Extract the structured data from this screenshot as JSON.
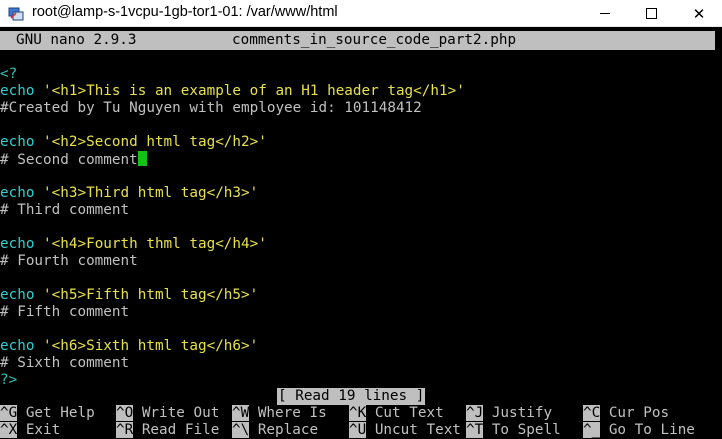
{
  "window": {
    "title": "root@lamp-s-1vcpu-1gb-tor1-01: /var/www/html",
    "minimize_glyph": "",
    "close_glyph": "✕"
  },
  "nano": {
    "version": "GNU nano 2.9.3",
    "filename": "comments_in_source_code_part2.php",
    "status": "[ Read 19 lines ]"
  },
  "code": {
    "open_tag": "<?",
    "l1_kw": "echo",
    "l1_str": "'<h1>This is an example of an H1 header tag</h1>'",
    "l2": "#Created by Tu Nguyen with employee id: 101148412",
    "l3_kw": "echo",
    "l3_str": "'<h2>Second html tag</h2>'",
    "l4": "# Second comment",
    "l5_kw": "echo",
    "l5_str": "'<h3>Third html tag</h3>'",
    "l6": "# Third comment",
    "l7_kw": "echo",
    "l7_str": "'<h4>Fourth thml tag</h4>'",
    "l8": "# Fourth comment",
    "l9_kw": "echo",
    "l9_str": "'<h5>Fifth html tag</h5>'",
    "l10": "# Fifth comment",
    "l11_kw": "echo",
    "l11_str": "'<h6>Sixth html tag</h6>'",
    "l12": "# Sixth comment",
    "close_tag": "?>"
  },
  "shortcuts": {
    "row1": [
      {
        "key": "^G",
        "label": "Get Help"
      },
      {
        "key": "^O",
        "label": "Write Out"
      },
      {
        "key": "^W",
        "label": "Where Is"
      },
      {
        "key": "^K",
        "label": "Cut Text"
      },
      {
        "key": "^J",
        "label": "Justify"
      },
      {
        "key": "^C",
        "label": "Cur Pos"
      }
    ],
    "row2": [
      {
        "key": "^X",
        "label": "Exit"
      },
      {
        "key": "^R",
        "label": "Read File"
      },
      {
        "key": "^\\",
        "label": "Replace"
      },
      {
        "key": "^U",
        "label": "Uncut Text"
      },
      {
        "key": "^T",
        "label": "To Spell"
      },
      {
        "key": "^_",
        "label": "Go To Line"
      }
    ]
  }
}
